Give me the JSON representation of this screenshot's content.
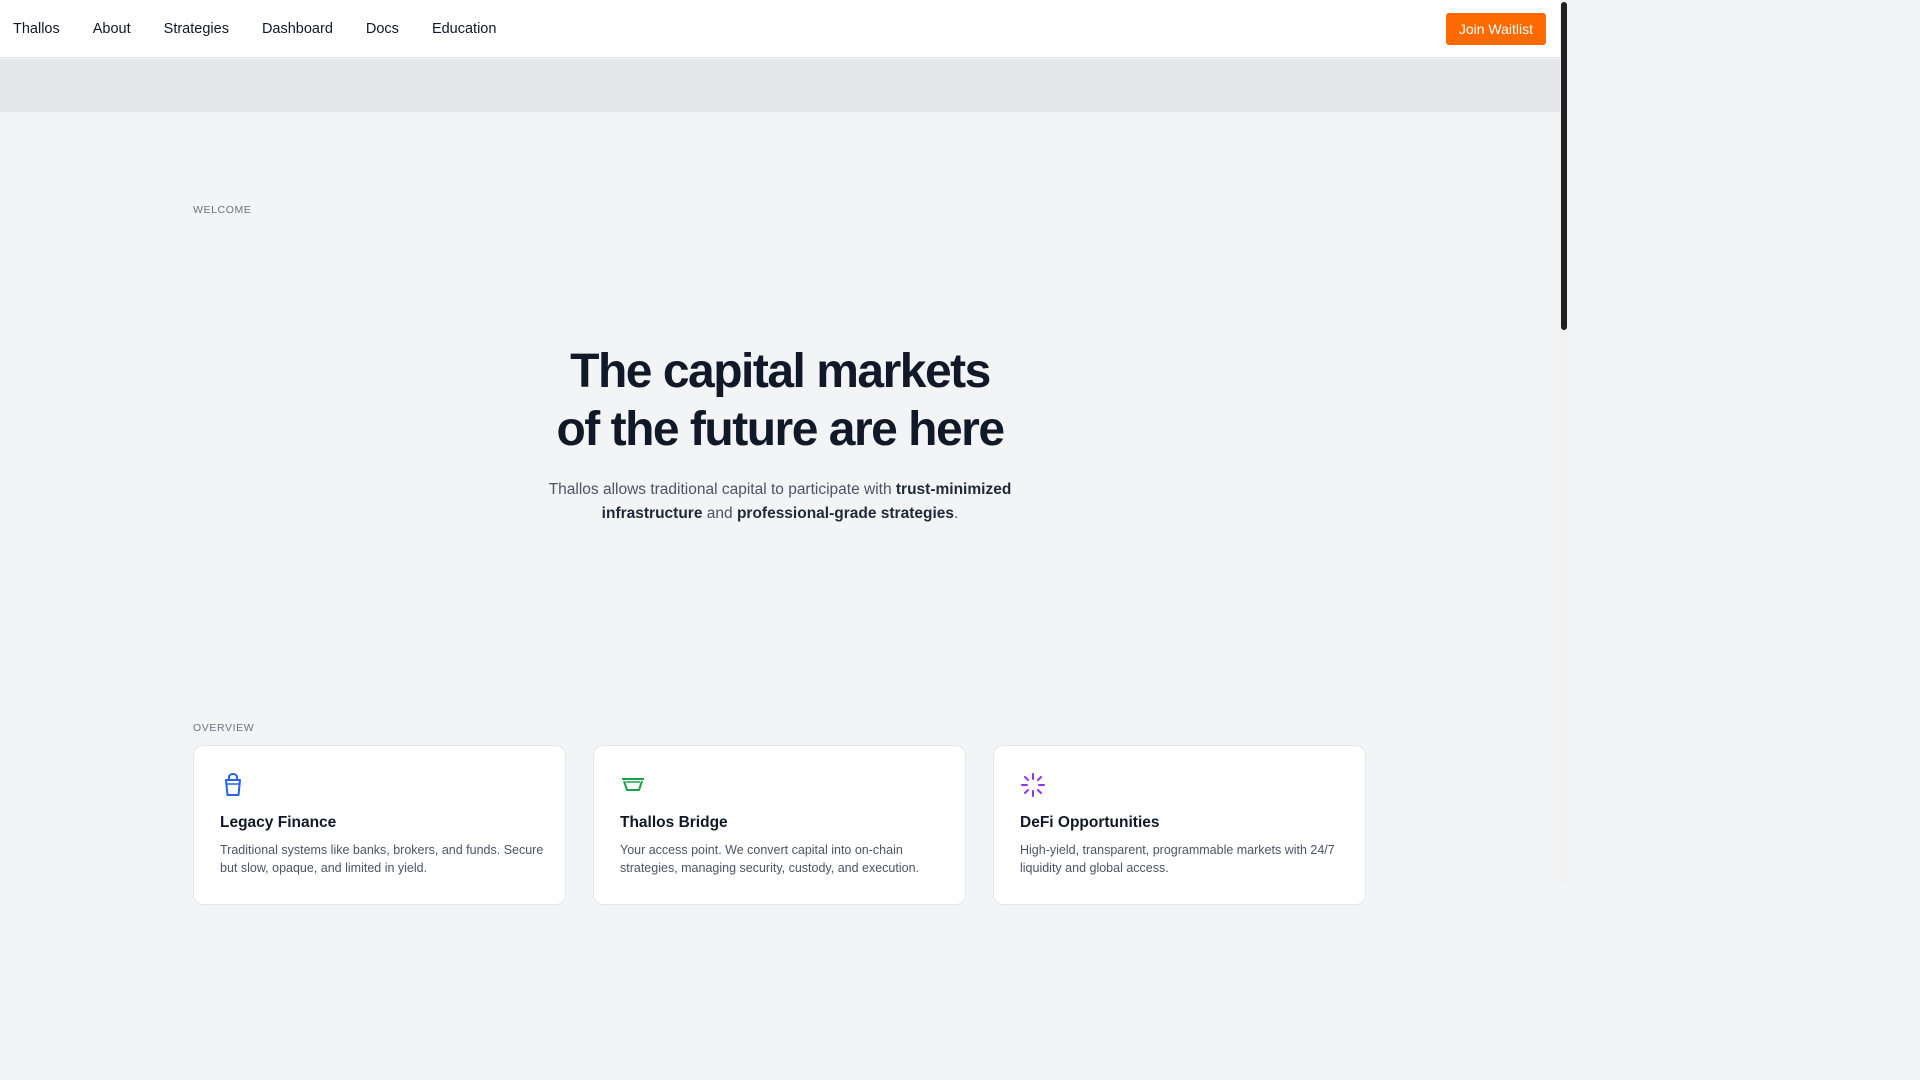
{
  "nav": {
    "brand": "Thallos",
    "links": [
      "About",
      "Strategies",
      "Dashboard",
      "Docs",
      "Education"
    ],
    "cta": "Join Waitlist"
  },
  "hero": {
    "eyebrow": "WELCOME",
    "title_line1": "The capital markets",
    "title_line2": "of the future are here",
    "sub_pre": "Thallos allows traditional capital to participate with ",
    "sub_bold1": "trust-minimized infrastructure",
    "sub_mid": " and ",
    "sub_bold2": "professional-grade strategies",
    "sub_end": "."
  },
  "overview": {
    "eyebrow": "OVERVIEW",
    "cards": [
      {
        "icon": "bucket-icon",
        "icon_color": "#2563eb",
        "title": "Legacy Finance",
        "desc": "Traditional systems like banks, brokers, and funds. Secure but slow, opaque, and limited in yield."
      },
      {
        "icon": "bridge-icon",
        "icon_color": "#16a34a",
        "title": "Thallos Bridge",
        "desc": "Your access point. We convert capital into on-chain strategies, managing security, custody, and execution."
      },
      {
        "icon": "spark-icon",
        "icon_color": "#9333ea",
        "title": "DeFi Opportunities",
        "desc": "High-yield, transparent, programmable markets with 24/7 liquidity and global access."
      }
    ]
  },
  "colors": {
    "accent": "#ff6a00",
    "background": "#f3f4f6",
    "banner": "#e5e7eb"
  }
}
